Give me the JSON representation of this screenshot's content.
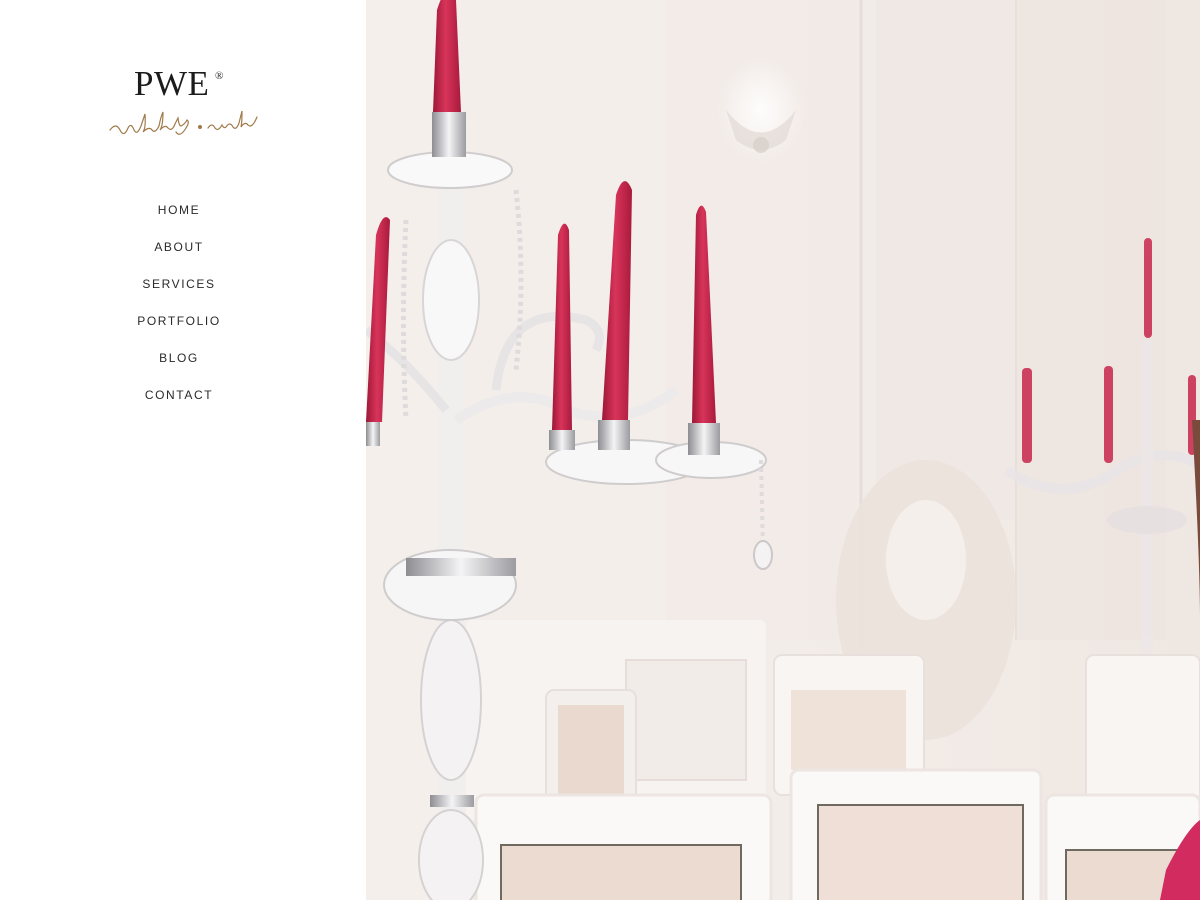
{
  "brand": {
    "mark": "PWE",
    "registered": "®",
    "tagline": "weddings • events"
  },
  "nav": {
    "items": [
      {
        "label": "HOME"
      },
      {
        "label": "ABOUT"
      },
      {
        "label": "SERVICES"
      },
      {
        "label": "PORTFOLIO"
      },
      {
        "label": "BLOG"
      },
      {
        "label": "CONTACT"
      }
    ]
  },
  "colors": {
    "brand_gold": "#a07a4a",
    "candle_red": "#c4224a",
    "text_dark": "#2a2a2a"
  }
}
